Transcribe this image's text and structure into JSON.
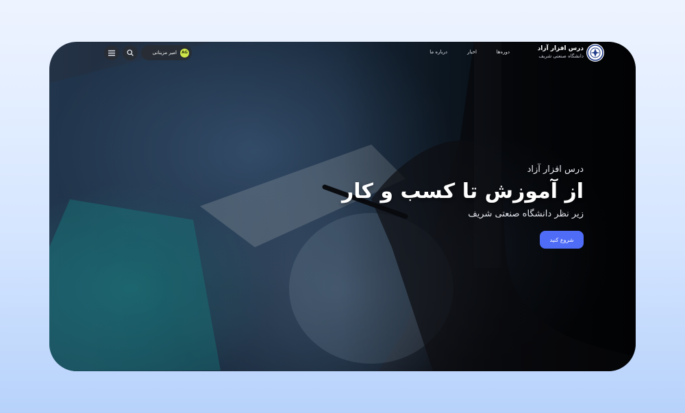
{
  "brand": {
    "title": "درس افزار آزاد",
    "subtitle": "دانشگاه صنعتی شریف"
  },
  "nav": {
    "items": [
      {
        "label": "دوره‌ها"
      },
      {
        "label": "اخبار"
      },
      {
        "label": "درباره ما"
      }
    ]
  },
  "user": {
    "name": "امیر مزینانی",
    "initials": "AG"
  },
  "icons": {
    "logo": "university-seal-icon",
    "search": "search-icon",
    "menu": "hamburger-menu-icon"
  },
  "hero": {
    "kicker": "درس افزار آزاد",
    "title": "از آموزش تا کسب و کار",
    "subtitle": "زیر نظر دانشگاه صنعتی شریف",
    "cta_label": "شروع کنید"
  },
  "colors": {
    "accent": "#4f6cf7",
    "avatar": "#cfe64a"
  }
}
